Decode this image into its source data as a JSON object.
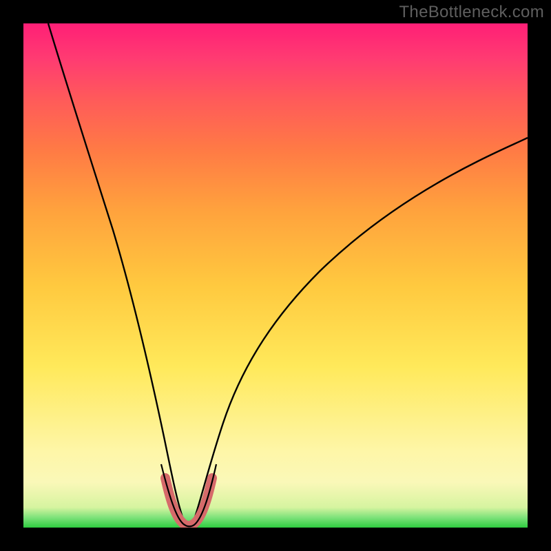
{
  "watermark": "TheBottleneck.com",
  "chart_data": {
    "type": "line",
    "title": "",
    "xlabel": "",
    "ylabel": "",
    "xlim": [
      0,
      100
    ],
    "ylim": [
      0,
      100
    ],
    "series": [
      {
        "name": "main-curve",
        "x": [
          5,
          8,
          12,
          16,
          20,
          24,
          27,
          29,
          30.5,
          32,
          33.5,
          35,
          38,
          42,
          48,
          55,
          62,
          70,
          78,
          86,
          94,
          100
        ],
        "y": [
          100,
          90,
          78,
          65,
          52,
          38,
          24,
          12,
          4,
          1,
          4,
          12,
          24,
          36,
          48,
          57,
          64,
          70,
          75,
          79,
          82,
          84
        ]
      },
      {
        "name": "bottom-highlight",
        "x": [
          27.5,
          29,
          30.5,
          32,
          33.5,
          35,
          36.5
        ],
        "y": [
          9,
          4,
          1.5,
          1,
          1.5,
          4,
          9
        ]
      }
    ],
    "colors": {
      "main_curve": "#000000",
      "highlight": "#d66a6a",
      "gradient_top": "#ff1f76",
      "gradient_bottom": "#2ecc40"
    }
  }
}
